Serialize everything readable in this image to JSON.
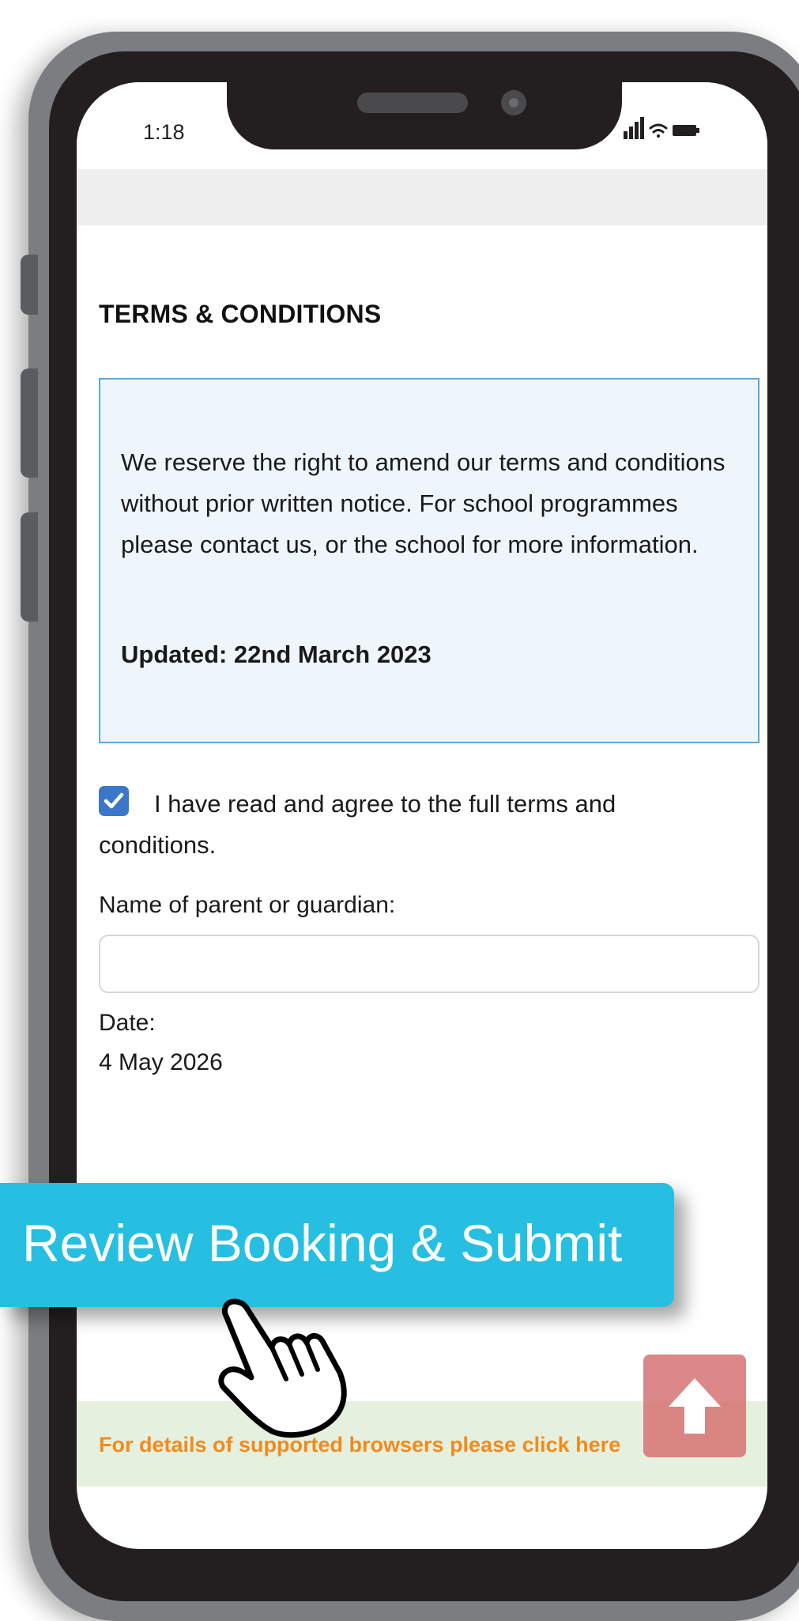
{
  "status_bar": {
    "time": "1:18",
    "icons": [
      "signal-icon",
      "wifi-icon",
      "battery-icon"
    ]
  },
  "section": {
    "title": "TERMS & CONDITIONS"
  },
  "terms_box": {
    "text": "We reserve the right to amend our terms and conditions without prior written notice. For school programmes please contact us, or the school for more information.",
    "updated": "Updated: 22nd March 2023"
  },
  "agreement": {
    "checked": true,
    "label": "I have read and agree to the full terms and conditions."
  },
  "guardian": {
    "label": "Name of parent or guardian:",
    "value": "",
    "placeholder": ""
  },
  "date": {
    "label": "Date:",
    "value": "4 May 2026"
  },
  "review_button": {
    "label": "Review Booking & Submit"
  },
  "footer": {
    "link_text": "For details of supported browsers please click here"
  },
  "scroll_top": {
    "icon": "arrow-up-icon"
  },
  "colors": {
    "accent": "#27bfe1",
    "checkbox": "#3a77c8",
    "footer_link": "#f28a1e",
    "terms_border": "#5fa7d6",
    "terms_bg": "#eef6fc",
    "footer_bg": "#e5f1de",
    "scroll_top": "#d66e6e"
  }
}
